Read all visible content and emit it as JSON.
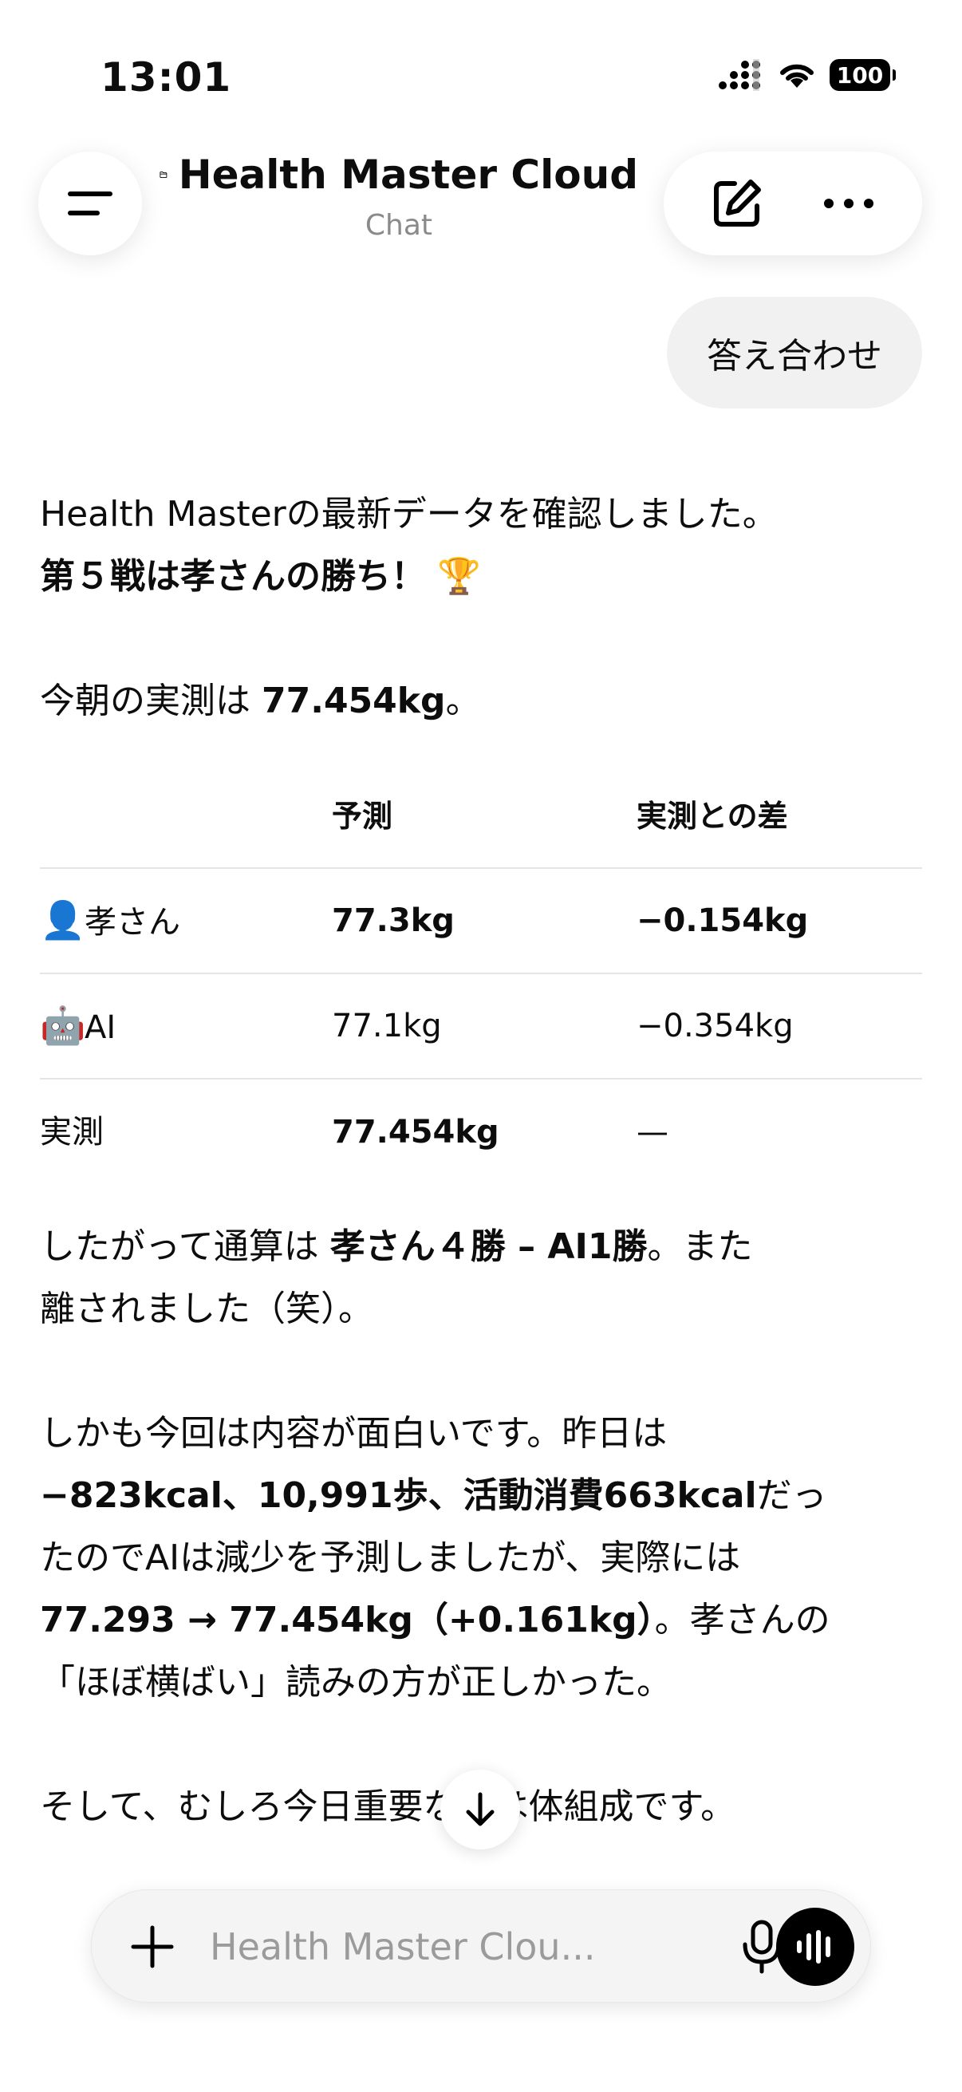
{
  "status_bar": {
    "time": "13:01",
    "battery": "100"
  },
  "header": {
    "title": "Health Master Cloud",
    "subtitle": "Chat"
  },
  "user_message": "答え合わせ",
  "assistant": {
    "intro_line1": "Health Masterの最新データを確認しました。",
    "intro_line2": "第５戦は孝さんの勝ち！",
    "trophy": "🏆",
    "measure_prefix": "今朝の実測は ",
    "measure_value": "77.454kg",
    "measure_suffix": "。",
    "table": {
      "headers": [
        "",
        "予測",
        "実測との差"
      ],
      "rows": [
        {
          "emoji": "👤",
          "name": "孝さん",
          "prediction": "77.3kg",
          "diff": "−0.154kg"
        },
        {
          "emoji": "🤖",
          "name": "AI",
          "prediction": "77.1kg",
          "diff": "−0.354kg"
        },
        {
          "emoji": "",
          "name": "実測",
          "prediction": "77.454kg",
          "diff": "—"
        }
      ]
    },
    "tally_prefix": "したがって通算は ",
    "tally_bold": "孝さん４勝 – AI1勝",
    "tally_suffix_line1": "。また",
    "tally_line2": "離されました（笑）。",
    "analysis_line1": "しかも今回は内容が面白いです。昨日は",
    "analysis_bold1": "−823kcal、10,991歩、活動消費663kcal",
    "analysis_text1": "だっ",
    "analysis_line3": "たのでAIは減少を予測しましたが、実際には",
    "analysis_bold2": "77.293 → 77.454kg（+0.161kg）",
    "analysis_text2": "。孝さんの",
    "analysis_line5": "「ほぼ横ばい」読みの方が正しかった。",
    "closing_line": "そして、むしろ今日重要なのは体組成です。"
  },
  "composer": {
    "placeholder": "Health Master Clou..."
  },
  "icons": {
    "menu": "hamburger-menu-icon",
    "folder": "folder-icon",
    "edit": "new-chat-icon",
    "more": "more-icon",
    "scroll": "arrow-down-icon",
    "plus": "plus-icon",
    "mic": "microphone-icon",
    "voice": "voice-mode-icon"
  }
}
